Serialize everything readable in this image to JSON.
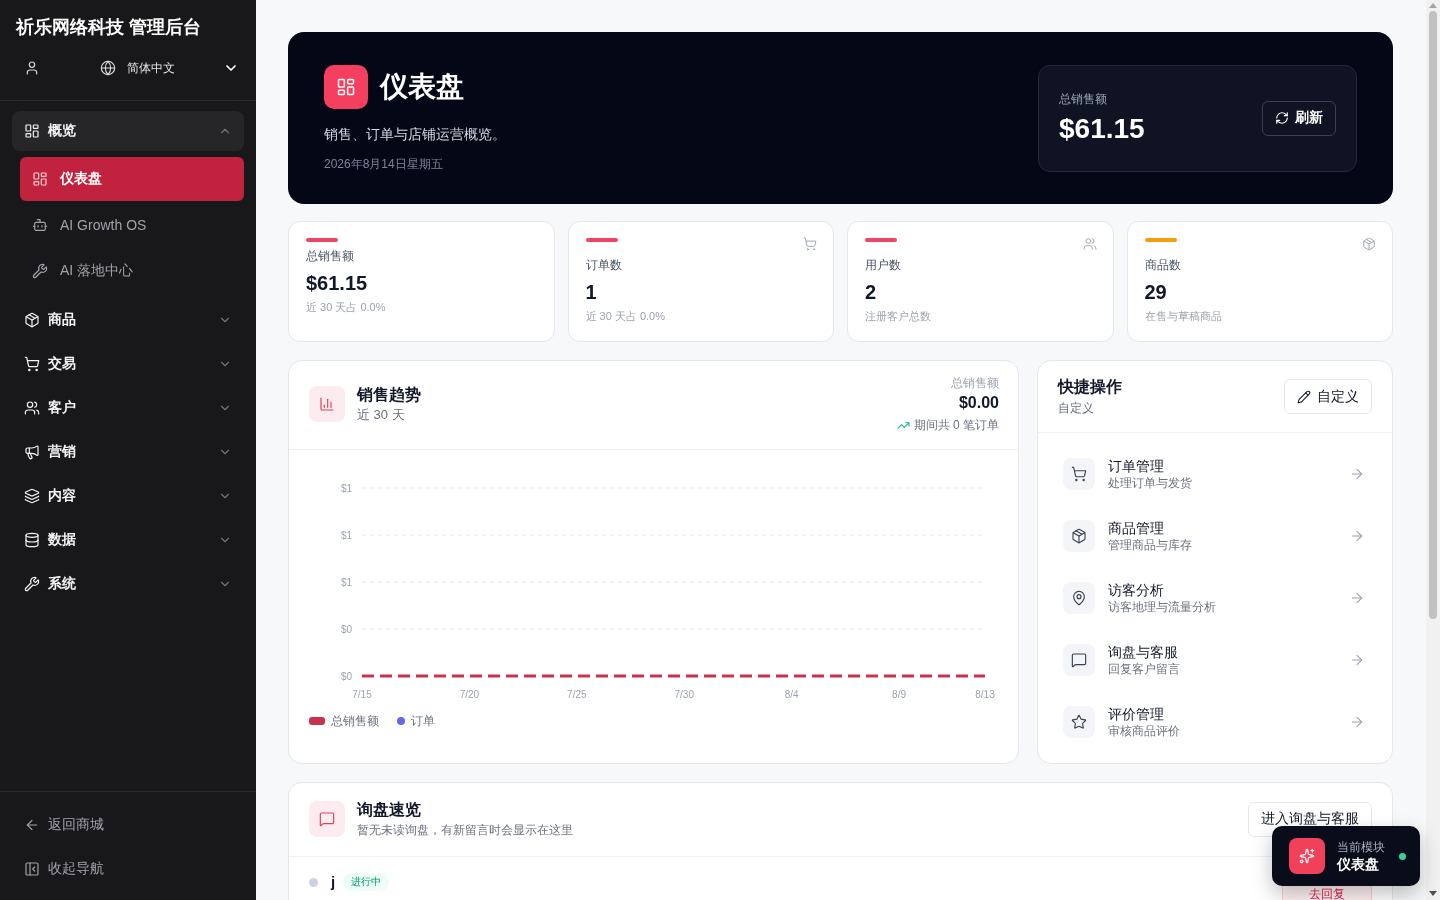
{
  "sidebar": {
    "brand": "祈乐网络科技 管理后台",
    "language": "简体中文",
    "nav": [
      {
        "label": "概览",
        "expanded": true,
        "children": [
          {
            "label": "仪表盘",
            "selected": true
          },
          {
            "label": "AI Growth OS",
            "selected": false
          },
          {
            "label": "AI 落地中心",
            "selected": false
          }
        ]
      },
      {
        "label": "商品",
        "expanded": false
      },
      {
        "label": "交易",
        "expanded": false
      },
      {
        "label": "客户",
        "expanded": false
      },
      {
        "label": "营销",
        "expanded": false
      },
      {
        "label": "内容",
        "expanded": false
      },
      {
        "label": "数据",
        "expanded": false
      },
      {
        "label": "系统",
        "expanded": false
      }
    ],
    "footer": [
      "返回商城",
      "收起导航"
    ]
  },
  "hero": {
    "title": "仪表盘",
    "subtitle": "销售、订单与店铺运营概览。",
    "date": "2026年8月14日星期五",
    "total_label": "总销售额",
    "total_value": "$61.15",
    "refresh_button": "刷新"
  },
  "stats": [
    {
      "label": "总销售额",
      "value": "$61.15",
      "note": "近 30 天占 0.0%",
      "color": "#ef4463"
    },
    {
      "label": "订单数",
      "value": "1",
      "note": "近 30 天占 0.0%",
      "color": "#ef4463"
    },
    {
      "label": "用户数",
      "value": "2",
      "note": "注册客户总数",
      "color": "#ef4463"
    },
    {
      "label": "商品数",
      "value": "29",
      "note": "在售与草稿商品",
      "color": "#f59e0b"
    }
  ],
  "sales_trend": {
    "title": "销售趋势",
    "subtitle": "近 30 天",
    "total_label": "总销售额",
    "total_value": "$0.00",
    "orders_summary": "期间共 0 笔订单",
    "chart_data": {
      "type": "line",
      "categories": [
        "7/15",
        null,
        null,
        null,
        null,
        "7/20",
        null,
        null,
        null,
        null,
        "7/25",
        null,
        null,
        null,
        null,
        "7/30",
        null,
        null,
        null,
        null,
        "8/4",
        null,
        null,
        null,
        null,
        "8/9",
        null,
        null,
        null,
        "8/13"
      ],
      "series": [
        {
          "name": "总销售额",
          "color": "#c8324d",
          "line_style": "dashed",
          "values": [
            0,
            0,
            0,
            0,
            0,
            0,
            0,
            0,
            0,
            0,
            0,
            0,
            0,
            0,
            0,
            0,
            0,
            0,
            0,
            0,
            0,
            0,
            0,
            0,
            0,
            0,
            0,
            0,
            0,
            0
          ]
        },
        {
          "name": "订单",
          "color": "#6366f1",
          "values": [
            null,
            null,
            null,
            null,
            null,
            null,
            null,
            null,
            null,
            null,
            null,
            null,
            null,
            null,
            null,
            null,
            null,
            null,
            null,
            null,
            null,
            null,
            null,
            null,
            null,
            null,
            null,
            null,
            null,
            null
          ]
        }
      ],
      "ylim": [
        0,
        1
      ],
      "yticks": [
        {
          "value": 1,
          "label": "$1"
        },
        {
          "value": 0.75,
          "label": "$1"
        },
        {
          "value": 0.5,
          "label": "$1"
        },
        {
          "value": 0.25,
          "label": "$0"
        },
        {
          "value": 0,
          "label": "$0"
        }
      ],
      "grid": true
    },
    "legend": [
      {
        "kind": "bar"
      },
      {
        "kind": "dot"
      }
    ]
  },
  "quick_actions": {
    "title": "快捷操作",
    "subtitle": "自定义",
    "customize_button": "自定义",
    "items": [
      {
        "title": "订单管理",
        "description": "处理订单与发货"
      },
      {
        "title": "商品管理",
        "description": "管理商品与库存"
      },
      {
        "title": "访客分析",
        "description": "访客地理与流量分析"
      },
      {
        "title": "询盘与客服",
        "description": "回复客户留言"
      },
      {
        "title": "评价管理",
        "description": "审核商品评价"
      }
    ]
  },
  "inquiries": {
    "title": "询盘速览",
    "subtitle": "暂无未读询盘，有新留言时会显示在这里",
    "open_button": "进入询盘与客服",
    "rows": [
      {
        "name": "j",
        "status": "进行中",
        "reply_button": "去回复"
      }
    ]
  },
  "current_module": {
    "label": "当前模块",
    "value": "仪表盘"
  }
}
